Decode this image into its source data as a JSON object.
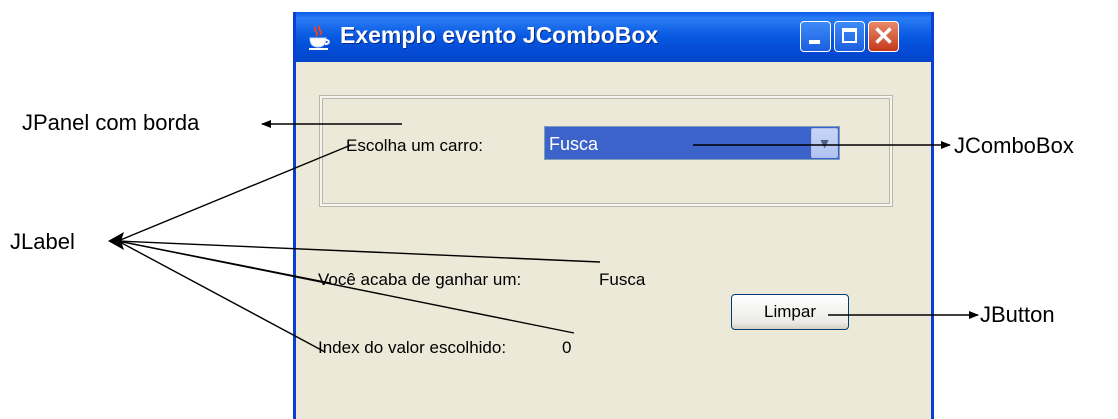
{
  "window": {
    "title": "Exemplo evento JComboBox",
    "icon": "java-cup-icon"
  },
  "form": {
    "combo_label": "Escolha um carro:",
    "combo_selected": "Fusca",
    "result_label": "Você acaba de ganhar um:",
    "result_value": "Fusca",
    "index_label": "Index do valor escolhido:",
    "index_value": "0",
    "button_label": "Limpar"
  },
  "annotations": {
    "panel": "JPanel com borda",
    "combobox": "JComboBox",
    "label": "JLabel",
    "button": "JButton"
  }
}
